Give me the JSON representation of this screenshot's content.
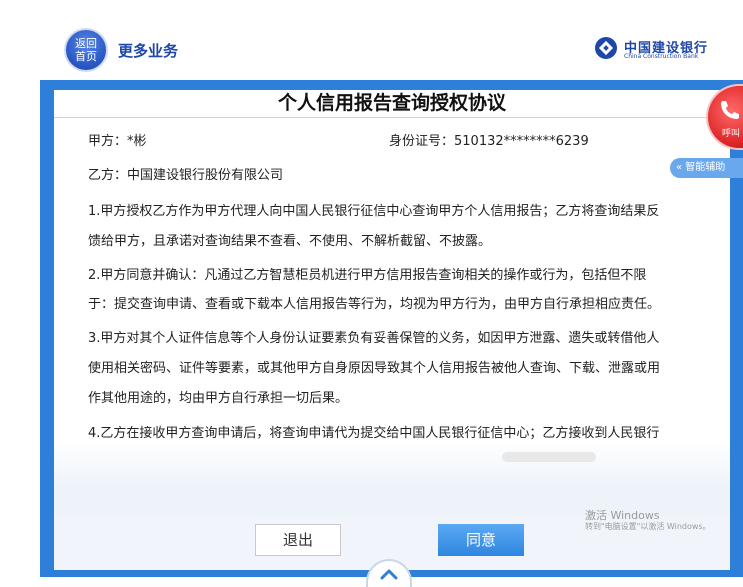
{
  "header": {
    "home_label_line1": "返回",
    "home_label_line2": "首页",
    "more_business": "更多业务",
    "bank_name_cn": "中国建设银行",
    "bank_name_en": "China Construction Bank"
  },
  "document": {
    "title": "个人信用报告查询授权协议",
    "party_a": "甲方：*彬",
    "id_number": "身份证号：510132********6239",
    "party_b": "乙方：中国建设银行股份有限公司",
    "lines": [
      "1.甲方授权乙方作为甲方代理人向中国人民银行征信中心查询甲方个人信用报告；乙方将查询结果反",
      "馈给甲方，且承诺对查询结果不查看、不使用、不解析截留、不披露。",
      "2.甲方同意并确认：凡通过乙方智慧柜员机进行甲方信用报告查询相关的操作或行为，包括但不限",
      "于：提交查询申请、查看或下载本人信用报告等行为，均视为甲方行为，由甲方自行承担相应责任。",
      "3.甲方对其个人证件信息等个人身份认证要素负有妥善保管的义务，如因甲方泄露、遗失或转借他人",
      "使用相关密码、证件等要素，或其他甲方自身原因导致其个人信用报告被他人查询、下载、泄露或用",
      "作其他用途的，均由甲方自行承担一切后果。",
      "4.乙方在接收甲方查询申请后，将查询申请代为提交给中国人民银行征信中心；乙方接收到人民银行"
    ]
  },
  "buttons": {
    "exit": "退出",
    "agree": "同意"
  },
  "side": {
    "call_label": "呼叫",
    "assist_label": "« 智能辅助"
  },
  "watermark": {
    "line1": "激活 Windows",
    "line2": "转到\"电脑设置\"以激活 Windows。"
  },
  "colors": {
    "frame_blue": "#2e7fd9",
    "brand_blue": "#1e47a8",
    "agree_blue": "#3b8ee6",
    "call_red": "#e0282a"
  }
}
